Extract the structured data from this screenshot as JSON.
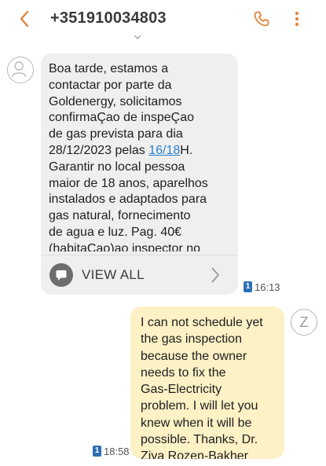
{
  "header": {
    "title": "+351910034803",
    "back_icon": "arrow-left",
    "call_icon": "phone",
    "menu_icon": "more-vertical",
    "accent_color": "#e0853b"
  },
  "messages": [
    {
      "direction": "incoming",
      "avatar_icon": "person",
      "text_before_link": "Boa tarde, estamos a\ncontactar por parte da\nGoldenergy, solicitamos\nconfirmaÇao de inspeÇao\nde gas prevista para dia\n28/12/2023 pelas ",
      "link_text": "16/18",
      "text_after_link": "H.\nGarantir no local pessoa\nmaior de 18 anos, aparelhos\ninstalados e adaptados para\ngas natural, fornecimento\nde agua e luz. Pag. 40€\n(habitaÇao)ao inspector no",
      "view_all_label": "VIEW ALL",
      "sim": "1",
      "time": "16:13",
      "bubble_color": "#efefef"
    },
    {
      "direction": "outgoing",
      "avatar_letter": "Z",
      "text": "I can not schedule yet\nthe gas inspection\nbecause the owner\nneeds to fix the\nGas-Electricity\nproblem. I will let you\nknew when it will be\npossible. Thanks, Dr.\nZiva Rozen-Bakher",
      "sim": "1",
      "time": "18:58",
      "bubble_color": "#fdf1c6"
    }
  ],
  "sim_badge_color": "#2d6fb3"
}
